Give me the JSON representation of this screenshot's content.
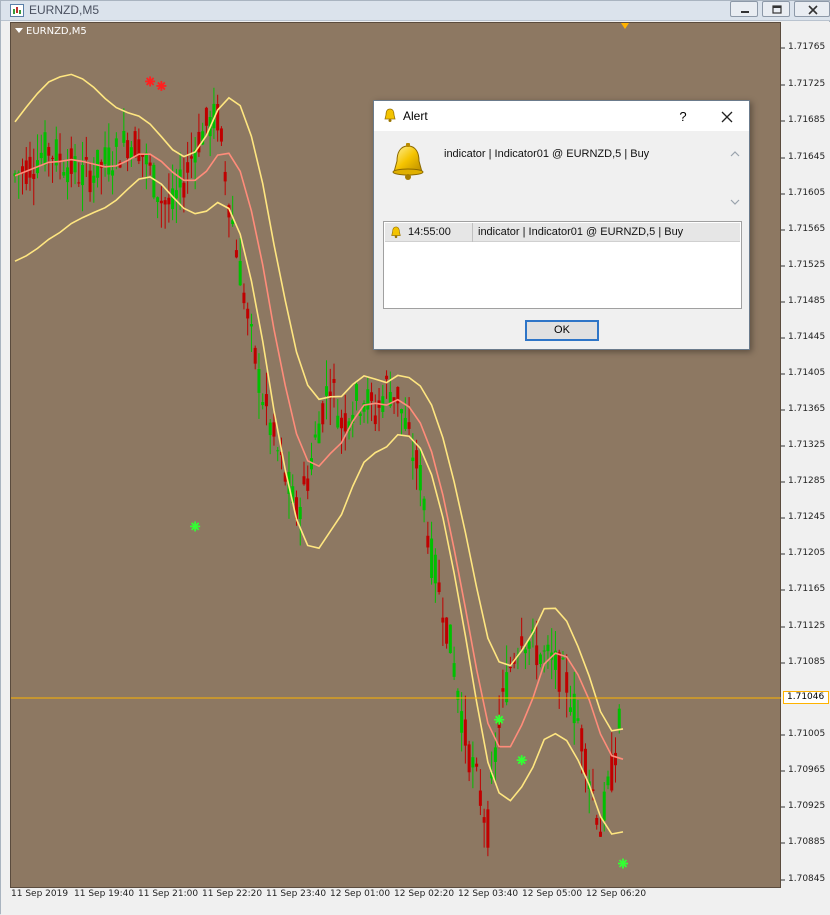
{
  "window": {
    "title": "EURNZD,M5"
  },
  "chart_label": "EURNZD,M5",
  "price_ticks": [
    "1.71765",
    "1.71725",
    "1.71685",
    "1.71645",
    "1.71605",
    "1.71565",
    "1.71525",
    "1.71485",
    "1.71445",
    "1.71405",
    "1.71365",
    "1.71325",
    "1.71285",
    "1.71245",
    "1.71205",
    "1.71165",
    "1.71125",
    "1.71085",
    "1.71005",
    "1.70965",
    "1.70925",
    "1.70885",
    "1.70845"
  ],
  "current_price": "1.71046",
  "time_ticks": [
    "11 Sep 2019",
    "11 Sep 19:40",
    "11 Sep 21:00",
    "11 Sep 22:20",
    "11 Sep 23:40",
    "12 Sep 01:00",
    "12 Sep 02:20",
    "12 Sep 03:40",
    "12 Sep 05:00",
    "12 Sep 06:20"
  ],
  "dialog": {
    "title": "Alert",
    "help": "?",
    "message": "indicator | Indicator01 @ EURNZD,5 | Buy",
    "row_time": "14:55:00",
    "row_message": "indicator | Indicator01 @ EURNZD,5 | Buy",
    "ok_label": "OK"
  },
  "colors": {
    "chart_bg": "#8d7862",
    "bull_candle": "#00c000",
    "bear_candle": "#c00000",
    "band_upper_lower": "#ffe680",
    "band_mid": "#ff8c7a",
    "price_line": "#ffb300",
    "buy_signal": "#33ff33",
    "sell_signal": "#ff2020"
  },
  "chart_data": {
    "type": "line",
    "series": [
      {
        "values": [
          1.71625,
          1.71635,
          1.71645,
          1.71655,
          1.71645,
          1.71635,
          1.71625,
          1.7163,
          1.7164,
          1.7165,
          1.71665,
          1.7166,
          1.7163,
          1.716,
          1.7159,
          1.7162,
          1.7166,
          1.7168,
          1.7169,
          1.716,
          1.7152,
          1.7144,
          1.7138,
          1.7133,
          1.7129,
          1.7125,
          1.7129,
          1.7135,
          1.714,
          1.7135,
          1.7137,
          1.7138,
          1.7136,
          1.7139,
          1.7138,
          1.7133,
          1.7129,
          1.712,
          1.7115,
          1.7108,
          1.71,
          1.7095,
          1.709,
          1.7102,
          1.7108,
          1.7112,
          1.711,
          1.7109,
          1.7108,
          1.7106,
          1.7102,
          1.7096,
          1.709,
          1.7096,
          1.7104
        ]
      }
    ],
    "ylim": [
      1.70835,
      1.71795
    ],
    "signals": {
      "buy": [
        {
          "x": 16,
          "y": 1.71235
        },
        {
          "x": 43,
          "y": 1.7102
        },
        {
          "x": 45,
          "y": 1.70975
        },
        {
          "x": 54,
          "y": 1.7086
        }
      ],
      "sell": [
        {
          "x": 12,
          "y": 1.7173
        },
        {
          "x": 13,
          "y": 1.71725
        }
      ]
    }
  }
}
